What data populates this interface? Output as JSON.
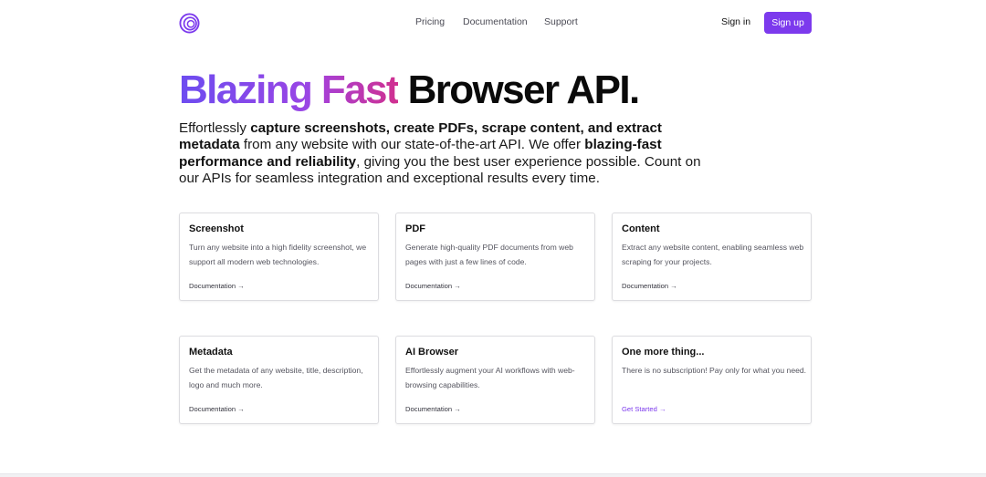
{
  "nav": {
    "logo_icon": "concentric-circles-logo-icon",
    "brand_color": "#7c3aed",
    "links": [
      {
        "label": "Pricing"
      },
      {
        "label": "Documentation"
      },
      {
        "label": "Support"
      }
    ],
    "sign_in": "Sign in",
    "sign_up": "Sign up"
  },
  "hero": {
    "title_part1": "Blazing",
    "title_part2": "Fast",
    "title_part3": "Browser API.",
    "desc": {
      "t1": "Effortlessly ",
      "b1": "capture screenshots, create PDFs, scrape content, and extract metadata",
      "t2": " from any website with our state-of-the-art API. We offer ",
      "b2": "blazing-fast performance and reliability",
      "t3": ", giving you the best user experience possible. Count on our APIs for seamless integration and exceptional results every time."
    }
  },
  "cards": [
    {
      "title": "Screenshot",
      "desc": "Turn any website into a high fidelity screenshot, we support all modern web technologies.",
      "link": "Documentation →"
    },
    {
      "title": "PDF",
      "desc": "Generate high-quality PDF documents from web pages with just a few lines of code.",
      "link": "Documentation →"
    },
    {
      "title": "Content",
      "desc": "Extract any website content, enabling seamless web scraping for your projects.",
      "link": "Documentation →"
    },
    {
      "title": "Metadata",
      "desc": "Get the metadata of any website, title, description, logo and much more.",
      "link": "Documentation →"
    },
    {
      "title": "AI Browser",
      "desc": "Effortlessly augment your AI workflows with web-browsing capabilities.",
      "link": "Documentation →"
    },
    {
      "title": "One more thing...",
      "desc": "There is no subscription! Pay only for what you need.",
      "link": "Get Started →"
    }
  ]
}
